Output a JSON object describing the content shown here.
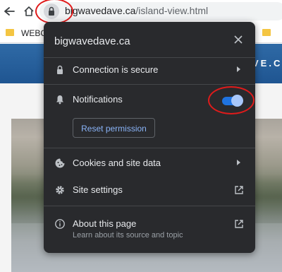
{
  "browser": {
    "url_domain": "bigwavedave.ca",
    "url_path": "/island-view.html",
    "bookmark_label": "WEBC"
  },
  "site": {
    "banner_text": "VE.C"
  },
  "popup": {
    "title": "bigwavedave.ca",
    "connection_label": "Connection is secure",
    "notifications_label": "Notifications",
    "notifications_enabled": true,
    "reset_permission_label": "Reset permission",
    "cookies_label": "Cookies and site data",
    "site_settings_label": "Site settings",
    "about_label": "About this page",
    "about_sublabel": "Learn about its source and topic"
  },
  "colors": {
    "popup_bg": "#292a2d",
    "accent": "#8ab4f8",
    "toggle_on": "#1f73e0",
    "annotation": "#e01b1b"
  },
  "icons": [
    "back-arrow-icon",
    "home-icon",
    "lock-icon",
    "bell-icon",
    "cookie-icon",
    "gear-icon",
    "info-icon",
    "external-link-icon",
    "chevron-right-icon",
    "close-icon",
    "folder-icon"
  ]
}
